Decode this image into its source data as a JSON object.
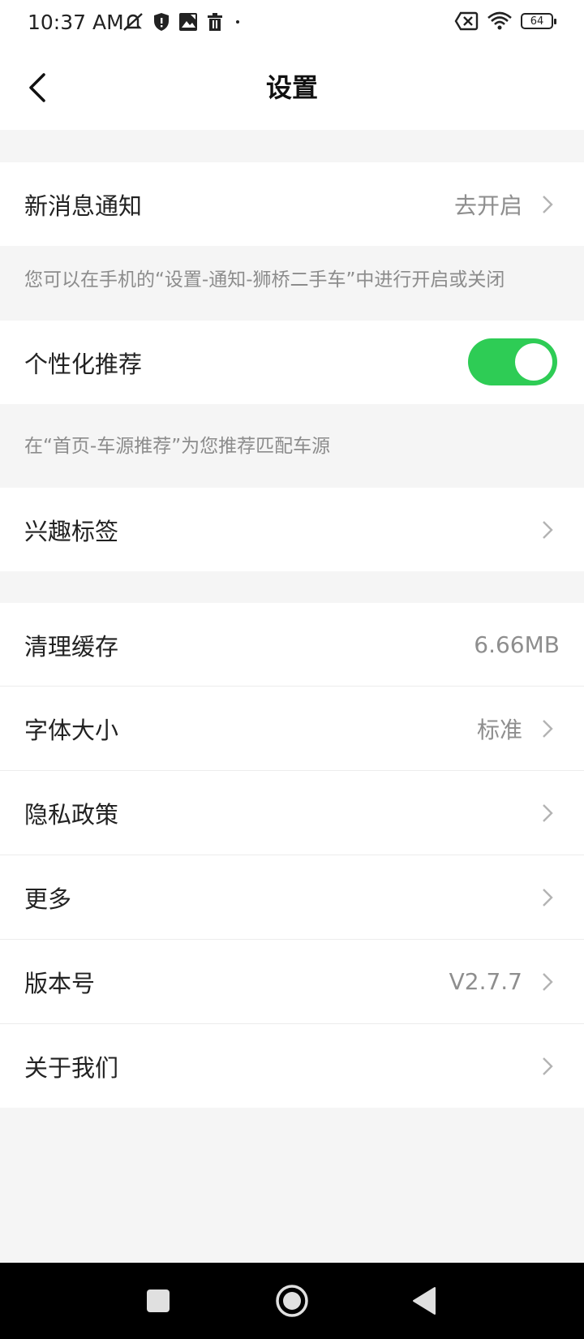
{
  "status_bar": {
    "time": "10:37 AM",
    "battery_level": "64",
    "icons_left": [
      "mute-icon",
      "shield-icon",
      "image-icon",
      "trash-icon",
      "dot-icon"
    ],
    "icons_right": [
      "sim-error-icon",
      "wifi-icon",
      "battery-icon"
    ]
  },
  "header": {
    "title": "设置",
    "back_icon": "chevron-left-icon"
  },
  "settings": {
    "new_message_notification": {
      "label": "新消息通知",
      "value": "去开启"
    },
    "notification_hint": "您可以在手机的“设置-通知-狮桥二手车”中进行开启或关闭",
    "personalized_recommendation": {
      "label": "个性化推荐",
      "enabled": true
    },
    "recommendation_hint": "在“首页-车源推荐”为您推荐匹配车源",
    "interest_tags": {
      "label": "兴趣标签"
    },
    "clear_cache": {
      "label": "清理缓存",
      "value": "6.66MB"
    },
    "font_size": {
      "label": "字体大小",
      "value": "标准"
    },
    "privacy_policy": {
      "label": "隐私政策"
    },
    "more": {
      "label": "更多"
    },
    "version": {
      "label": "版本号",
      "value": "V2.7.7"
    },
    "about_us": {
      "label": "关于我们"
    }
  },
  "colors": {
    "toggle_on": "#2ecc55",
    "background": "#f5f5f5",
    "secondary_text": "#8e8e8e"
  },
  "system_nav": [
    "recents-square-icon",
    "home-circle-icon",
    "back-triangle-icon"
  ]
}
